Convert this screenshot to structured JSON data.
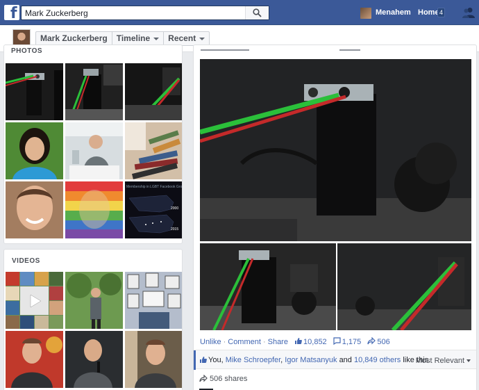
{
  "topbar": {
    "search_value": "Mark Zuckerberg",
    "logo_letter": "f",
    "user_name": "Menahem",
    "home_label": "Home",
    "home_count": "4",
    "brand_color": "#3b5998"
  },
  "subbar": {
    "breadcrumbs": [
      "Mark Zuckerberg",
      "Timeline",
      "Recent"
    ]
  },
  "photos": {
    "title": "PHOTOS"
  },
  "videos": {
    "title": "VIDEOS"
  },
  "photo_captions": {
    "map_title": "Membership in LGBT Facebook Groups",
    "year_1": "2000",
    "year_2": "2015"
  },
  "post": {
    "actions": {
      "like": "Unlike",
      "comment": "Comment",
      "share": "Share",
      "like_count": "10,852",
      "comment_count": "1,175",
      "share_count": "506"
    },
    "likes": {
      "you": "You,",
      "person_1": "Mike Schroepfer",
      "person_2": "Igor Matsanyuk",
      "and": "and",
      "others": "10,849 others",
      "suffix": "like this.",
      "sort_label": "Most Relevant"
    },
    "shares_text": "506 shares"
  }
}
